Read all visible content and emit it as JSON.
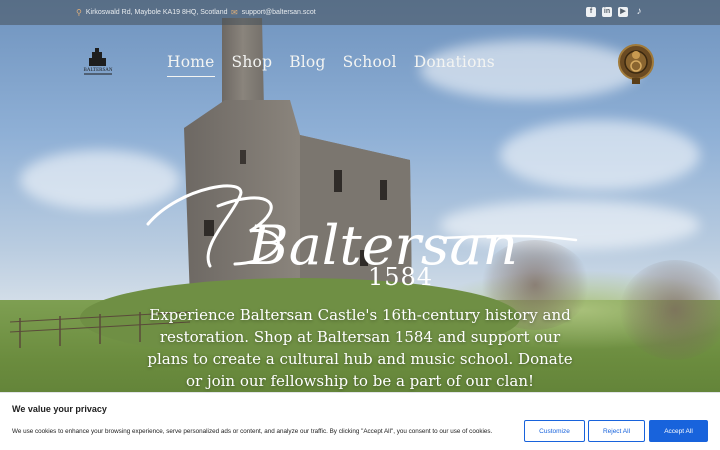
{
  "topbar": {
    "address": "Kirkoswald Rd, Maybole KA19 8HQ, Scotland",
    "email": "support@baltersan.scot",
    "social": [
      {
        "icon": "facebook-icon",
        "glyph": "f"
      },
      {
        "icon": "linkedin-icon",
        "glyph": "in"
      },
      {
        "icon": "youtube-icon",
        "glyph": "▶"
      },
      {
        "icon": "tiktok-icon",
        "glyph": "♪"
      }
    ]
  },
  "logo": {
    "text": "BALTERSAN"
  },
  "nav": {
    "items": [
      "Home",
      "Shop",
      "Blog",
      "School",
      "Donations"
    ],
    "active": "Home"
  },
  "hero": {
    "title": "Baltersan",
    "year": "1584",
    "tagline": "Experience Baltersan Castle's 16th-century history and restoration. Shop at Baltersan 1584 and support our plans to create a cultural hub and music school. Donate or join our fellowship to be a part of our clan!"
  },
  "cookie": {
    "title": "We value your privacy",
    "text": "We use cookies to enhance your browsing experience, serve personalized ads or content, and analyze our traffic. By clicking \"Accept All\", you consent to our use of cookies.",
    "customize": "Customize",
    "reject": "Reject All",
    "accept": "Accept All"
  },
  "colors": {
    "accent": "#1863dc",
    "topbar_icon": "#e0b07a"
  }
}
